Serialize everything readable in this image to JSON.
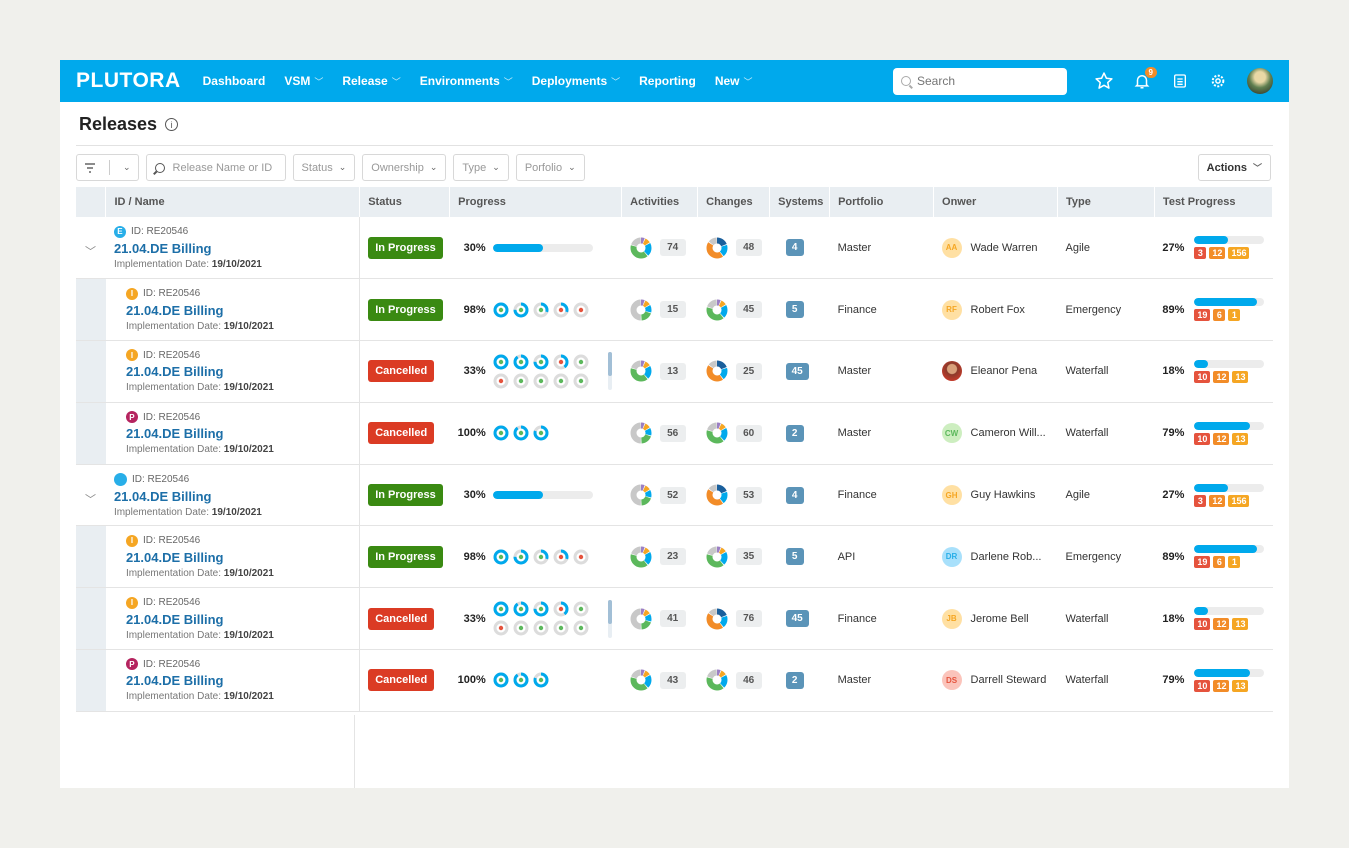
{
  "app": {
    "logo": "PLUTORA",
    "nav": [
      {
        "label": "Dashboard",
        "dropdown": false
      },
      {
        "label": "VSM",
        "dropdown": true
      },
      {
        "label": "Release",
        "dropdown": true
      },
      {
        "label": "Environments",
        "dropdown": true
      },
      {
        "label": "Deployments",
        "dropdown": true
      },
      {
        "label": "Reporting",
        "dropdown": false
      },
      {
        "label": "New",
        "dropdown": true
      }
    ],
    "search_placeholder": "Search",
    "notification_count": "9",
    "icons": [
      "star-icon",
      "bell-icon",
      "clipboard-icon",
      "gear-icon",
      "user-avatar"
    ]
  },
  "page": {
    "title": "Releases",
    "filters": {
      "search_placeholder": "Release Name or ID",
      "dropdowns": [
        "Status",
        "Ownership",
        "Type",
        "Porfolio"
      ],
      "actions_label": "Actions"
    }
  },
  "colors": {
    "brand": "#00a9ec",
    "in_progress": "#3a8a12",
    "cancelled": "#db3b24",
    "link": "#1d6fa8",
    "systems": "#5b94b8"
  },
  "table": {
    "columns": [
      "ID / Name",
      "Status",
      "Progress",
      "Activities",
      "Changes",
      "Systems",
      "Portfolio",
      "Onwer",
      "Type",
      "Test Progress"
    ],
    "rows": [
      {
        "level": "parent",
        "expanded": true,
        "badge": "E",
        "badge_color": "#28aee8",
        "id": "ID: RE20546",
        "name": "21.04.DE Billing",
        "date_label": "Implementation Date:",
        "date": "19/10/2021",
        "status": "In Progress",
        "progress": "30%",
        "progress_type": "bar",
        "progress_value": 0.5,
        "activities": "74",
        "activities_pie": "green",
        "changes": "48",
        "changes_pie": "orange",
        "systems": "4",
        "portfolio": "Master",
        "owner_initials": "AA",
        "owner": "Wade Warren",
        "owner_color": "#ffe0a3",
        "owner_text": "#f5a623",
        "type": "Agile",
        "test_pct": "27%",
        "test_value": 0.48,
        "test_counts": [
          "3",
          "12",
          "156"
        ]
      },
      {
        "level": "child",
        "badge": "I",
        "badge_color": "#f5a623",
        "id": "ID: RE20546",
        "name": "21.04.DE Billing",
        "date_label": "Implementation Date:",
        "date": "19/10/2021",
        "status": "In Progress",
        "progress": "98%",
        "progress_type": "rings",
        "rings": [
          [
            1.0,
            "g"
          ],
          [
            0.75,
            "g"
          ],
          [
            0.3,
            "g"
          ],
          [
            0.3,
            "r"
          ],
          [
            0,
            "r"
          ]
        ],
        "activities": "15",
        "activities_pie": "grey",
        "changes": "45",
        "changes_pie": "green",
        "systems": "5",
        "portfolio": "Finance",
        "owner_initials": "RF",
        "owner": "Robert Fox",
        "owner_color": "#ffe0a3",
        "owner_text": "#f5a623",
        "type": "Emergency",
        "test_pct": "89%",
        "test_value": 0.9,
        "test_counts": [
          "19",
          "6",
          "1"
        ]
      },
      {
        "level": "child",
        "badge": "I",
        "badge_color": "#f5a623",
        "id": "ID: RE20546",
        "name": "21.04.DE Billing",
        "date_label": "Implementation Date:",
        "date": "19/10/2021",
        "status": "Cancelled",
        "progress": "33%",
        "progress_type": "rings",
        "scroll": true,
        "rings": [
          [
            1.0,
            "g"
          ],
          [
            0.9,
            "g"
          ],
          [
            0.75,
            "g"
          ],
          [
            0.4,
            "r"
          ],
          [
            0,
            "g"
          ],
          [
            0,
            "r"
          ],
          [
            0,
            "g"
          ],
          [
            0,
            "g"
          ],
          [
            0,
            "g"
          ],
          [
            0,
            "g"
          ]
        ],
        "activities": "13",
        "activities_pie": "green",
        "changes": "25",
        "changes_pie": "orange",
        "systems": "45",
        "portfolio": "Master",
        "owner_initials": "",
        "owner": "Eleanor Pena",
        "owner_color": "#8b3a2a",
        "owner_text": "#fff",
        "type": "Waterfall",
        "test_pct": "18%",
        "test_value": 0.2,
        "test_counts": [
          "10",
          "12",
          "13"
        ]
      },
      {
        "level": "child",
        "badge": "P",
        "badge_color": "#b5245f",
        "id": "ID: RE20546",
        "name": "21.04.DE Billing",
        "date_label": "Implementation Date:",
        "date": "19/10/2021",
        "status": "Cancelled",
        "progress": "100%",
        "progress_type": "rings",
        "rings": [
          [
            1.0,
            "g"
          ],
          [
            0.9,
            "g"
          ],
          [
            0.8,
            "g"
          ]
        ],
        "activities": "56",
        "activities_pie": "grey",
        "changes": "60",
        "changes_pie": "green",
        "systems": "2",
        "portfolio": "Master",
        "owner_initials": "CW",
        "owner": "Cameron Will...",
        "owner_color": "#cdeec0",
        "owner_text": "#5cb85c",
        "type": "Waterfall",
        "test_pct": "79%",
        "test_value": 0.8,
        "test_counts": [
          "10",
          "12",
          "13"
        ]
      },
      {
        "level": "parent",
        "expanded": true,
        "badge": "",
        "badge_color": "#28aee8",
        "id": "ID: RE20546",
        "name": "21.04.DE Billing",
        "date_label": "Implementation Date:",
        "date": "19/10/2021",
        "status": "In Progress",
        "progress": "30%",
        "progress_type": "bar",
        "progress_value": 0.5,
        "activities": "52",
        "activities_pie": "grey",
        "changes": "53",
        "changes_pie": "orange",
        "systems": "4",
        "portfolio": "Finance",
        "owner_initials": "GH",
        "owner": "Guy Hawkins",
        "owner_color": "#ffe0a3",
        "owner_text": "#f5a623",
        "type": "Agile",
        "test_pct": "27%",
        "test_value": 0.48,
        "test_counts": [
          "3",
          "12",
          "156"
        ]
      },
      {
        "level": "child",
        "badge": "I",
        "badge_color": "#f5a623",
        "id": "ID: RE20546",
        "name": "21.04.DE Billing",
        "date_label": "Implementation Date:",
        "date": "19/10/2021",
        "status": "In Progress",
        "progress": "98%",
        "progress_type": "rings",
        "rings": [
          [
            1.0,
            "g"
          ],
          [
            0.75,
            "g"
          ],
          [
            0.3,
            "g"
          ],
          [
            0.3,
            "r"
          ],
          [
            0,
            "r"
          ]
        ],
        "activities": "23",
        "activities_pie": "green",
        "changes": "35",
        "changes_pie": "green",
        "systems": "5",
        "portfolio": "API",
        "owner_initials": "DR",
        "owner": "Darlene Rob...",
        "owner_color": "#a8e0fb",
        "owner_text": "#28aee8",
        "type": "Emergency",
        "test_pct": "89%",
        "test_value": 0.9,
        "test_counts": [
          "19",
          "6",
          "1"
        ]
      },
      {
        "level": "child",
        "badge": "I",
        "badge_color": "#f5a623",
        "id": "ID: RE20546",
        "name": "21.04.DE Billing",
        "date_label": "Implementation Date:",
        "date": "19/10/2021",
        "status": "Cancelled",
        "progress": "33%",
        "progress_type": "rings",
        "scroll": true,
        "rings": [
          [
            1.0,
            "g"
          ],
          [
            0.9,
            "g"
          ],
          [
            0.75,
            "g"
          ],
          [
            0.4,
            "r"
          ],
          [
            0,
            "g"
          ],
          [
            0,
            "r"
          ],
          [
            0,
            "g"
          ],
          [
            0,
            "g"
          ],
          [
            0,
            "g"
          ],
          [
            0,
            "g"
          ]
        ],
        "activities": "41",
        "activities_pie": "grey",
        "changes": "76",
        "changes_pie": "orange",
        "systems": "45",
        "portfolio": "Finance",
        "owner_initials": "JB",
        "owner": "Jerome Bell",
        "owner_color": "#ffe0a3",
        "owner_text": "#f5a623",
        "type": "Waterfall",
        "test_pct": "18%",
        "test_value": 0.2,
        "test_counts": [
          "10",
          "12",
          "13"
        ]
      },
      {
        "level": "child",
        "badge": "P",
        "badge_color": "#b5245f",
        "id": "ID: RE20546",
        "name": "21.04.DE Billing",
        "date_label": "Implementation Date:",
        "date": "19/10/2021",
        "status": "Cancelled",
        "progress": "100%",
        "progress_type": "rings",
        "rings": [
          [
            1.0,
            "g"
          ],
          [
            0.9,
            "g"
          ],
          [
            0.8,
            "g"
          ]
        ],
        "activities": "43",
        "activities_pie": "green",
        "changes": "46",
        "changes_pie": "green",
        "systems": "2",
        "portfolio": "Master",
        "owner_initials": "DS",
        "owner": "Darrell Steward",
        "owner_color": "#fbc4bb",
        "owner_text": "#e5533d",
        "type": "Waterfall",
        "test_pct": "79%",
        "test_value": 0.8,
        "test_counts": [
          "10",
          "12",
          "13"
        ]
      }
    ]
  }
}
